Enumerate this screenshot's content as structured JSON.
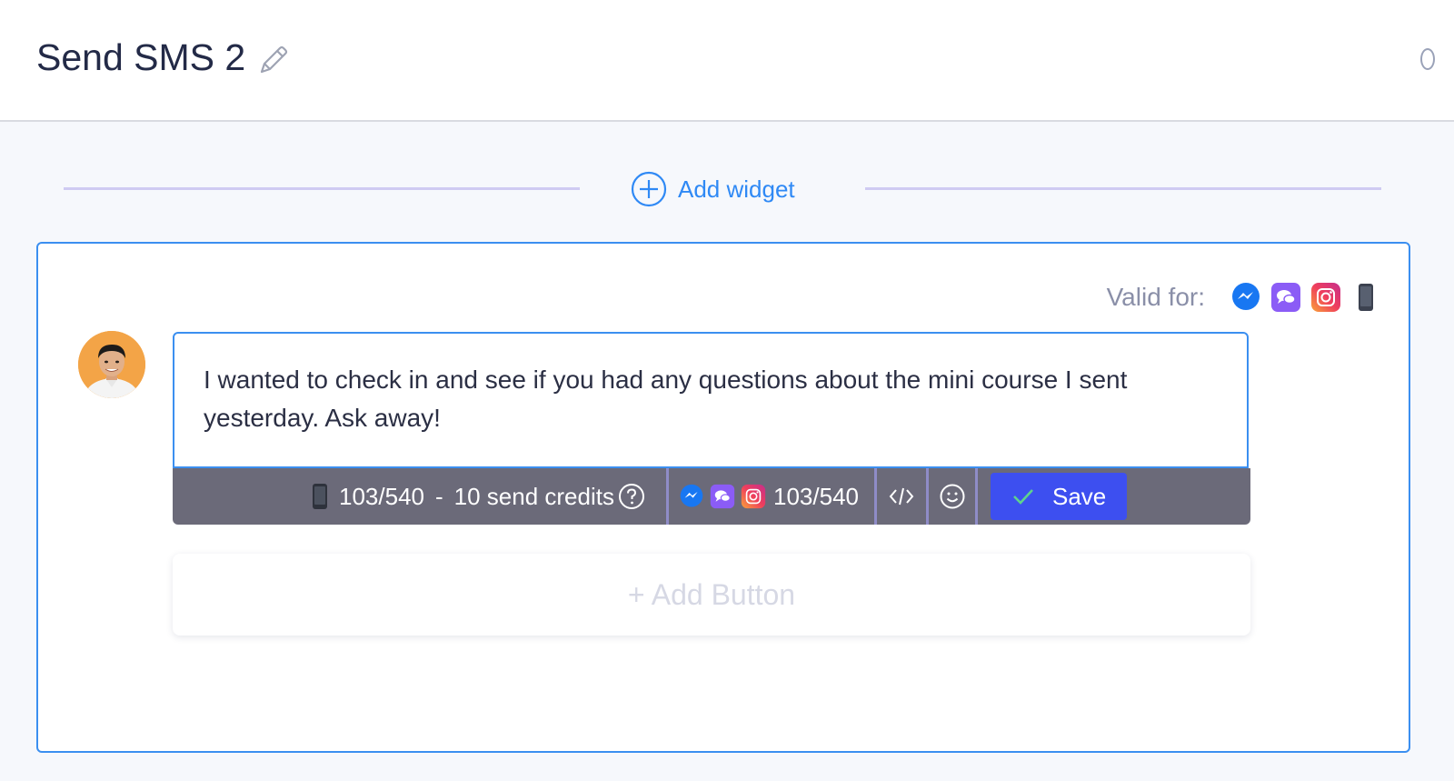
{
  "header": {
    "title": "Send SMS 2",
    "edit_icon": "pencil-icon"
  },
  "add_widget": {
    "label": "Add widget",
    "icon": "plus-circle-icon"
  },
  "card": {
    "valid_for": {
      "label": "Valid for:",
      "channels": [
        "messenger-icon",
        "chat-icon",
        "instagram-icon",
        "phone-icon"
      ]
    },
    "message": {
      "text": "I wanted to check in and see if you had any questions about the mini course I sent yesterday. Ask away!"
    },
    "toolbar": {
      "sms_count": "103/540",
      "dash": "-",
      "credits": "10 send credits",
      "help_icon": "question-circle-icon",
      "social_count": "103/540",
      "code_icon": "code-icon",
      "emoji_icon": "smiley-icon",
      "save_label": "Save"
    },
    "add_button_label": "+ Add Button"
  },
  "colors": {
    "accent": "#3b8ff0",
    "add_widget": "#2f89f5",
    "toolbar_bg": "#6b6a79",
    "save_bg": "#3d4ff0",
    "messenger": "#1877f2",
    "chat": "#8b5cf6"
  }
}
